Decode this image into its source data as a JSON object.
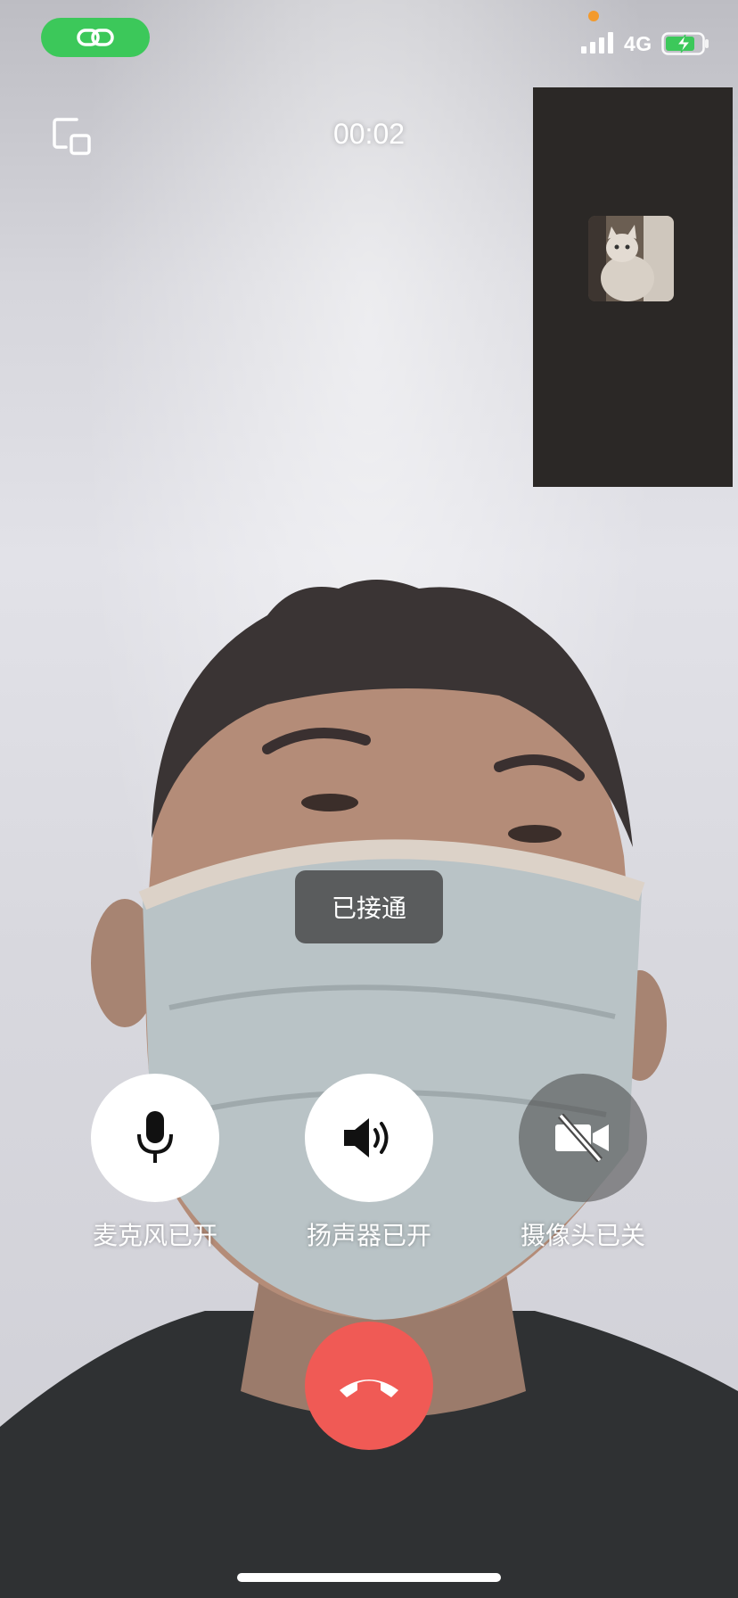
{
  "status_bar": {
    "network": "4G",
    "call_pill_color": "#3cc85a",
    "icons": [
      "link-icon",
      "signal-bars-icon",
      "battery-charging-icon"
    ]
  },
  "call": {
    "timer": "00:02",
    "toast": "已接通"
  },
  "controls": {
    "mic": {
      "label": "麦克风已开",
      "state": "on",
      "icon": "microphone-icon"
    },
    "speaker": {
      "label": "扬声器已开",
      "state": "on",
      "icon": "speaker-icon"
    },
    "camera": {
      "label": "摄像头已关",
      "state": "off",
      "icon": "camera-off-icon"
    }
  },
  "hangup": {
    "color": "#f05a55",
    "icon": "hangup-phone-icon"
  },
  "local_preview": {
    "avatar": "cat-avatar"
  }
}
